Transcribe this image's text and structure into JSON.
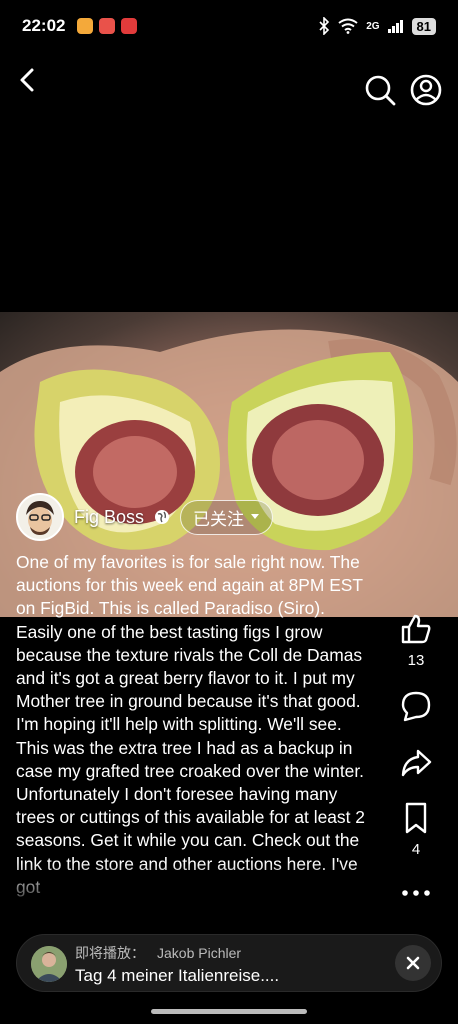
{
  "status_bar": {
    "time": "22:02",
    "network": "2G",
    "battery": "81"
  },
  "author": {
    "name": "Fig Boss",
    "follow_label": "已关注"
  },
  "caption": "One of my favorites is for sale right now. The auctions for this week end again at 8PM EST on FigBid. This is called Paradiso (Siro). Easily one of the best tasting figs I grow because the texture rivals the Coll de Damas and it's got a great berry flavor to it. I put my Mother tree in ground because it's that good. I'm hoping it'll help with splitting. We'll see. This was the extra tree I had as a backup in case my grafted tree croaked over the winter. Unfortunately I don't foresee having many trees or cuttings of this available for at least 2 seasons. Get it while you can. Check out the link to the store and other auctions here. I've got",
  "actions": {
    "like_count": "13",
    "save_count": "4"
  },
  "mini_player": {
    "upnext_label": "即将播放：",
    "channel": "Jakob Pichler",
    "title": "Tag 4 meiner Italienreise...."
  },
  "icons": {
    "back": "chevron-left-icon",
    "search": "search-icon",
    "profile": "account-circle-icon",
    "like": "thumbs-up-icon",
    "comment": "comment-icon",
    "share": "share-arrow-icon",
    "save": "bookmark-icon",
    "more": "more-horizontal-icon",
    "close": "close-icon",
    "globe": "globe-icon"
  }
}
